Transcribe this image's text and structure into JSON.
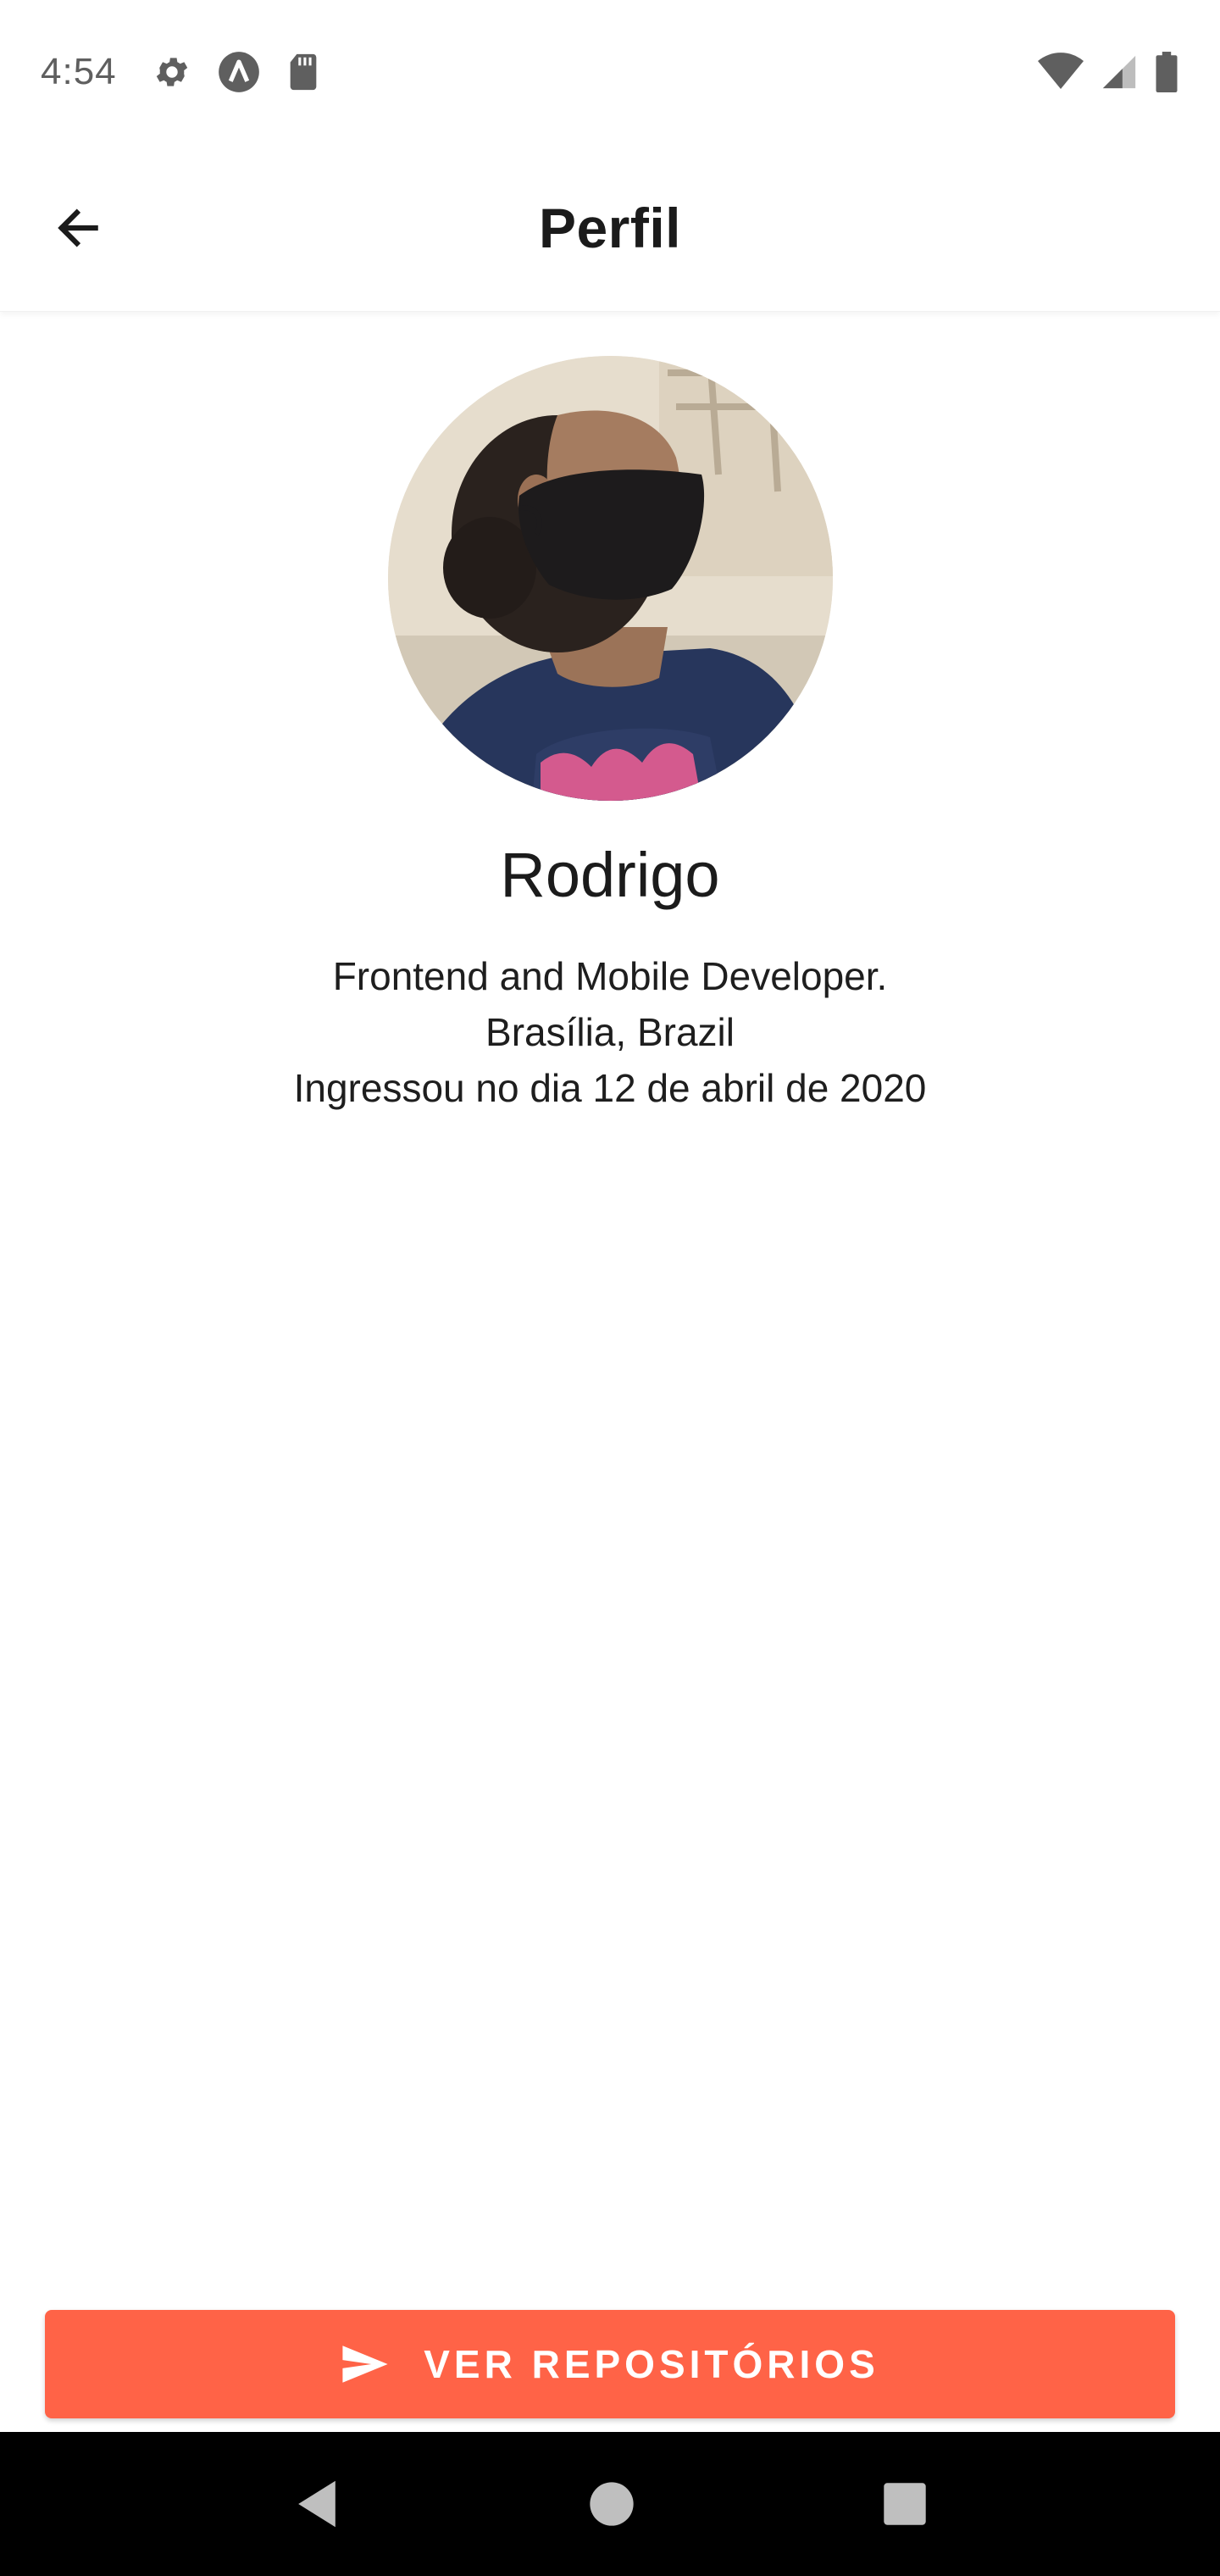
{
  "status_bar": {
    "time": "4:54",
    "icons_left": [
      "gear-icon",
      "a-icon",
      "sd-card-icon"
    ],
    "icons_right": [
      "wifi-icon",
      "signal-icon",
      "battery-icon"
    ]
  },
  "app_bar": {
    "title": "Perfil",
    "back_icon": "arrow-left-icon"
  },
  "profile": {
    "name": "Rodrigo",
    "bio": "Frontend and Mobile Developer.",
    "location": "Brasília, Brazil",
    "joined": "Ingressou no dia 12 de abril de 2020"
  },
  "repos_button": {
    "label": "VER REPOSITÓRIOS",
    "icon": "send-icon",
    "color": "#ff6347"
  },
  "nav_bar": {
    "icons": [
      "back-triangle-icon",
      "home-circle-icon",
      "recents-square-icon"
    ]
  }
}
